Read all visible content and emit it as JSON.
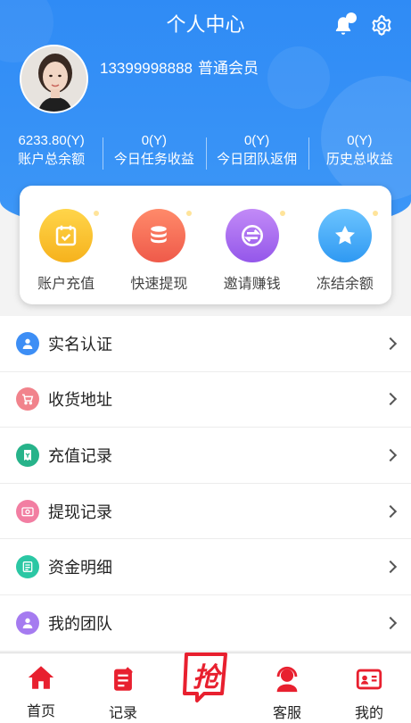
{
  "header": {
    "title": "个人中心",
    "colors": {
      "primary": "#2f8bf5",
      "accent_red": "#e8202f"
    },
    "icons": [
      "bell-icon",
      "gear-icon"
    ]
  },
  "user": {
    "phone": "13399998888",
    "level": "普通会员"
  },
  "stats": [
    {
      "value": "6233.80(Y)",
      "label": "账户总余额"
    },
    {
      "value": "0(Y)",
      "label": "今日任务收益"
    },
    {
      "value": "0(Y)",
      "label": "今日团队返佣"
    },
    {
      "value": "0(Y)",
      "label": "历史总收益"
    }
  ],
  "quick_actions": [
    {
      "label": "账户充值",
      "icon": "calendar-check-icon",
      "color": "#fbbd24"
    },
    {
      "label": "快速提现",
      "icon": "coin-stack-icon",
      "color": "#f56a56"
    },
    {
      "label": "邀请赚钱",
      "icon": "exchange-icon",
      "color": "#a66bf0"
    },
    {
      "label": "冻结余额",
      "icon": "star-icon",
      "color": "#3aa7f5"
    }
  ],
  "menu": [
    {
      "label": "实名认证",
      "icon": "user-id-icon",
      "color": "#3d8ef5"
    },
    {
      "label": "收货地址",
      "icon": "cart-icon",
      "color": "#f1838c"
    },
    {
      "label": "充值记录",
      "icon": "receipt-icon",
      "color": "#27b38a"
    },
    {
      "label": "提现记录",
      "icon": "wallet-icon",
      "color": "#f27ea2"
    },
    {
      "label": "资金明细",
      "icon": "ledger-icon",
      "color": "#2bc7a4"
    },
    {
      "label": "我的团队",
      "icon": "team-icon",
      "color": "#a57bf0"
    }
  ],
  "tabbar": {
    "home": "首页",
    "records": "记录",
    "grab": "抢",
    "service": "客服",
    "mine": "我的"
  }
}
